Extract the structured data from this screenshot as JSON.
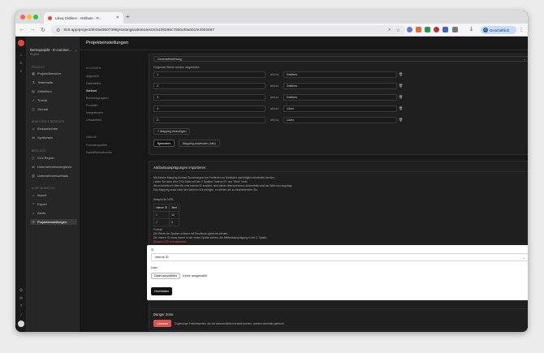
{
  "browser": {
    "tab_title": "Likeq Dislikes - Attribute - P...",
    "url": "9z8.app/project/8f43af3507398y/settings/attributes/3c5108289c78bbdf0abb1fe20b2b57",
    "profile_label": "Geschäftlich",
    "profile_initial": "G"
  },
  "sidebar": {
    "project_name": "Demoprojekt - E-commer...",
    "project_sub": "Projekt",
    "sections": {
      "projekt": "PROJEKT",
      "analysen": "ANALYSEN & BERICHTE",
      "berichte": "BERICHTE",
      "konfiguration": "KONFIGURATION"
    },
    "items": [
      {
        "label": "Projektübersicht",
        "icon": "grid-icon"
      },
      {
        "label": "Testinhalte",
        "icon": "flask-icon"
      },
      {
        "label": "Zeitreihen",
        "icon": "calendar-icon"
      },
      {
        "label": "Trends",
        "icon": "trend-icon"
      },
      {
        "label": "Journal",
        "icon": "book-icon"
      },
      {
        "label": "Einkaufskörbe",
        "icon": "basket-icon"
      },
      {
        "label": "Synthesen",
        "icon": "merge-icon"
      },
      {
        "label": "CLV-Report",
        "icon": "report-icon"
      },
      {
        "label": "Unternehmensvergleich",
        "icon": "compare-icon"
      },
      {
        "label": "Unternehmensdetails",
        "icon": "building-icon"
      },
      {
        "label": "Import",
        "icon": "import-icon"
      },
      {
        "label": "Export",
        "icon": "export-icon"
      },
      {
        "label": "Alerts",
        "icon": "bell-icon"
      },
      {
        "label": "Projekteinstellungen",
        "icon": "gear-icon"
      }
    ]
  },
  "main": {
    "header_title": "Projekteinstellungen",
    "subnav": {
      "heading_general": "ALLGEMEIN",
      "heading_other": "ABBILDE",
      "items": [
        "Allgemein",
        "Datenfeflex",
        "Attribute",
        "Benutzergruppen",
        "Produkte",
        "Integrationen",
        "Umsatzfeed",
        "Fremdenquellen",
        "Kaufdifferenzbundle"
      ]
    },
    "mapping": {
      "dropdown": "Generalbewertung",
      "hint": "Folgende Werte werden abgebildet:",
      "arrow_label": "wird zu",
      "rows": [
        {
          "id": "1",
          "value": "Dislikes"
        },
        {
          "id": "2",
          "value": "Dislikes"
        },
        {
          "id": "3",
          "value": "Dislikes"
        },
        {
          "id": "4",
          "value": "Likes"
        },
        {
          "id": "5",
          "value": "Likes"
        }
      ],
      "add_label": "+ Mapping hinzufügen",
      "save_label": "Speichern",
      "preview_label": "Mapping anwenden (Info)"
    },
    "import_card": {
      "title": "Attributsausprägungen importieren",
      "desc_lines": [
        "Mit diesem Mapping können Zuordnungen von Freitexten zu Attributen nachträglich bearbeitet werden.",
        "Laden Sie dazu eine CSV-Datei mit den 2 Spalten \"Interne ID\" und \"Wert\" hoch.",
        "Wenn bereits ein Wert für eine Interne ID existiert, wird dieser überschrieben. Andernfalls wird der Wert neu angelegt.",
        "Das Mapping muss nach den internen IDs erfolgen, es stehen die zu bearbeitenden IDs."
      ],
      "example_label": "Beispiel für NPS:",
      "table_headers": [
        "Interne ID",
        "Wert"
      ],
      "table_rows": [
        [
          "1",
          "10"
        ],
        [
          "2",
          "8"
        ]
      ],
      "format_lines": [
        "Format:",
        "Die Werte der Spalten müssen mit Semikolon getrennt werden.",
        "Die Interne ID muss immer in der ersten Spalte stehen, die Attributsausprägung in der 2. Spalte."
      ],
      "warning_line": "Beispiel CSV herunterladen",
      "id_label": "ID",
      "id_select": "Interne ID",
      "file_label": "Datei",
      "choose_label": "Datei auswählen",
      "no_file_label": "Keine ausgewählt",
      "upload_label": "Hochladen"
    },
    "danger": {
      "title": "Danger Zone",
      "delete_label": "Löschen",
      "warning": "Zugehörige Freitextwerten, die mit diesem Attribut erstellt wurden, werden ebenfalls gelöscht"
    }
  },
  "colors": {
    "danger": "#d9534f",
    "brand": "#e0483a",
    "sidebar_bg": "#262626",
    "main_bg": "#181818"
  }
}
